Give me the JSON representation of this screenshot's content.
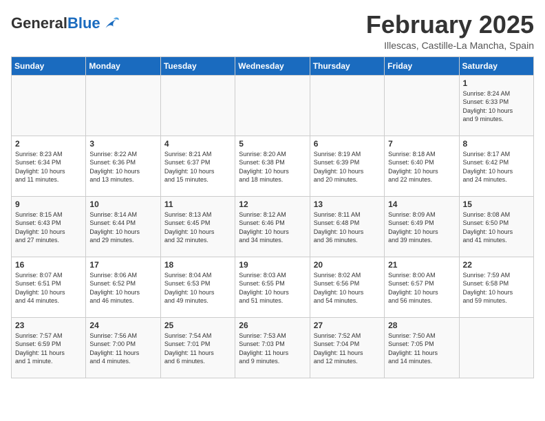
{
  "header": {
    "logo_general": "General",
    "logo_blue": "Blue",
    "title": "February 2025",
    "subtitle": "Illescas, Castille-La Mancha, Spain"
  },
  "weekdays": [
    "Sunday",
    "Monday",
    "Tuesday",
    "Wednesday",
    "Thursday",
    "Friday",
    "Saturday"
  ],
  "weeks": [
    [
      {
        "day": "",
        "info": ""
      },
      {
        "day": "",
        "info": ""
      },
      {
        "day": "",
        "info": ""
      },
      {
        "day": "",
        "info": ""
      },
      {
        "day": "",
        "info": ""
      },
      {
        "day": "",
        "info": ""
      },
      {
        "day": "1",
        "info": "Sunrise: 8:24 AM\nSunset: 6:33 PM\nDaylight: 10 hours\nand 9 minutes."
      }
    ],
    [
      {
        "day": "2",
        "info": "Sunrise: 8:23 AM\nSunset: 6:34 PM\nDaylight: 10 hours\nand 11 minutes."
      },
      {
        "day": "3",
        "info": "Sunrise: 8:22 AM\nSunset: 6:36 PM\nDaylight: 10 hours\nand 13 minutes."
      },
      {
        "day": "4",
        "info": "Sunrise: 8:21 AM\nSunset: 6:37 PM\nDaylight: 10 hours\nand 15 minutes."
      },
      {
        "day": "5",
        "info": "Sunrise: 8:20 AM\nSunset: 6:38 PM\nDaylight: 10 hours\nand 18 minutes."
      },
      {
        "day": "6",
        "info": "Sunrise: 8:19 AM\nSunset: 6:39 PM\nDaylight: 10 hours\nand 20 minutes."
      },
      {
        "day": "7",
        "info": "Sunrise: 8:18 AM\nSunset: 6:40 PM\nDaylight: 10 hours\nand 22 minutes."
      },
      {
        "day": "8",
        "info": "Sunrise: 8:17 AM\nSunset: 6:42 PM\nDaylight: 10 hours\nand 24 minutes."
      }
    ],
    [
      {
        "day": "9",
        "info": "Sunrise: 8:15 AM\nSunset: 6:43 PM\nDaylight: 10 hours\nand 27 minutes."
      },
      {
        "day": "10",
        "info": "Sunrise: 8:14 AM\nSunset: 6:44 PM\nDaylight: 10 hours\nand 29 minutes."
      },
      {
        "day": "11",
        "info": "Sunrise: 8:13 AM\nSunset: 6:45 PM\nDaylight: 10 hours\nand 32 minutes."
      },
      {
        "day": "12",
        "info": "Sunrise: 8:12 AM\nSunset: 6:46 PM\nDaylight: 10 hours\nand 34 minutes."
      },
      {
        "day": "13",
        "info": "Sunrise: 8:11 AM\nSunset: 6:48 PM\nDaylight: 10 hours\nand 36 minutes."
      },
      {
        "day": "14",
        "info": "Sunrise: 8:09 AM\nSunset: 6:49 PM\nDaylight: 10 hours\nand 39 minutes."
      },
      {
        "day": "15",
        "info": "Sunrise: 8:08 AM\nSunset: 6:50 PM\nDaylight: 10 hours\nand 41 minutes."
      }
    ],
    [
      {
        "day": "16",
        "info": "Sunrise: 8:07 AM\nSunset: 6:51 PM\nDaylight: 10 hours\nand 44 minutes."
      },
      {
        "day": "17",
        "info": "Sunrise: 8:06 AM\nSunset: 6:52 PM\nDaylight: 10 hours\nand 46 minutes."
      },
      {
        "day": "18",
        "info": "Sunrise: 8:04 AM\nSunset: 6:53 PM\nDaylight: 10 hours\nand 49 minutes."
      },
      {
        "day": "19",
        "info": "Sunrise: 8:03 AM\nSunset: 6:55 PM\nDaylight: 10 hours\nand 51 minutes."
      },
      {
        "day": "20",
        "info": "Sunrise: 8:02 AM\nSunset: 6:56 PM\nDaylight: 10 hours\nand 54 minutes."
      },
      {
        "day": "21",
        "info": "Sunrise: 8:00 AM\nSunset: 6:57 PM\nDaylight: 10 hours\nand 56 minutes."
      },
      {
        "day": "22",
        "info": "Sunrise: 7:59 AM\nSunset: 6:58 PM\nDaylight: 10 hours\nand 59 minutes."
      }
    ],
    [
      {
        "day": "23",
        "info": "Sunrise: 7:57 AM\nSunset: 6:59 PM\nDaylight: 11 hours\nand 1 minute."
      },
      {
        "day": "24",
        "info": "Sunrise: 7:56 AM\nSunset: 7:00 PM\nDaylight: 11 hours\nand 4 minutes."
      },
      {
        "day": "25",
        "info": "Sunrise: 7:54 AM\nSunset: 7:01 PM\nDaylight: 11 hours\nand 6 minutes."
      },
      {
        "day": "26",
        "info": "Sunrise: 7:53 AM\nSunset: 7:03 PM\nDaylight: 11 hours\nand 9 minutes."
      },
      {
        "day": "27",
        "info": "Sunrise: 7:52 AM\nSunset: 7:04 PM\nDaylight: 11 hours\nand 12 minutes."
      },
      {
        "day": "28",
        "info": "Sunrise: 7:50 AM\nSunset: 7:05 PM\nDaylight: 11 hours\nand 14 minutes."
      },
      {
        "day": "",
        "info": ""
      }
    ]
  ]
}
